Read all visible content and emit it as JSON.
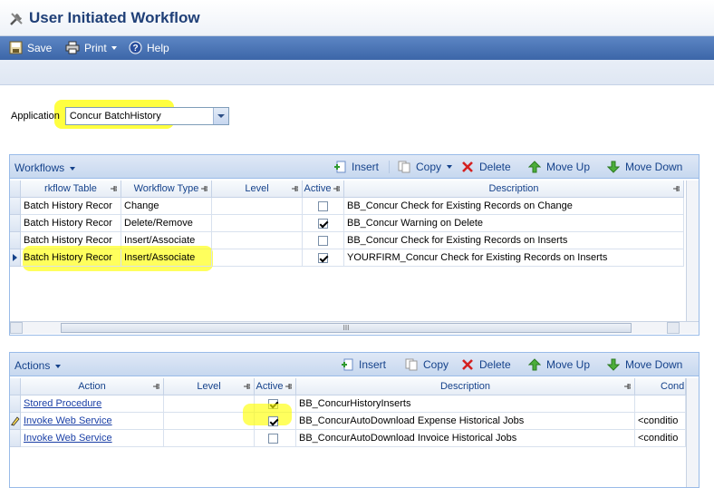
{
  "window": {
    "title": "User Initiated Workflow"
  },
  "toolbar": {
    "save": "Save",
    "print": "Print",
    "help": "Help"
  },
  "application": {
    "label": "Application",
    "value": "Concur BatchHistory"
  },
  "workflows": {
    "title": "Workflows",
    "buttons": {
      "insert": "Insert",
      "copy": "Copy",
      "delete": "Delete",
      "move_up": "Move Up",
      "move_down": "Move Down"
    },
    "columns": [
      "rkflow Table",
      "Workflow Type",
      "Level",
      "Active",
      "Description"
    ],
    "rows": [
      {
        "table": "Batch History Recor",
        "type": "Change",
        "level": "",
        "active": false,
        "description": "BB_Concur Check for Existing Records on Change"
      },
      {
        "table": "Batch History Recor",
        "type": "Delete/Remove",
        "level": "",
        "active": true,
        "description": "BB_Concur Warning on Delete"
      },
      {
        "table": "Batch History Recor",
        "type": "Insert/Associate",
        "level": "",
        "active": false,
        "description": "BB_Concur Check for Existing Records on Inserts"
      },
      {
        "table": "Batch History Recor",
        "type": "Insert/Associate",
        "level": "",
        "active": true,
        "description": "YOURFIRM_Concur Check for Existing Records on Inserts"
      }
    ],
    "scroll_glyph": "III"
  },
  "actions": {
    "title": "Actions",
    "buttons": {
      "insert": "Insert",
      "copy": "Copy",
      "delete": "Delete",
      "move_up": "Move Up",
      "move_down": "Move Down"
    },
    "columns": [
      "Action",
      "Level",
      "Active",
      "Description",
      "Cond"
    ],
    "rows": [
      {
        "action": "Stored Procedure",
        "level": "",
        "active": true,
        "description": "BB_ConcurHistoryInserts",
        "cond": ""
      },
      {
        "action": "Invoke Web Service",
        "level": "",
        "active": true,
        "description": "BB_ConcurAutoDownload Expense Historical Jobs",
        "cond": "<conditio"
      },
      {
        "action": "Invoke Web Service",
        "level": "",
        "active": false,
        "description": "BB_ConcurAutoDownload Invoice Historical Jobs",
        "cond": "<conditio"
      }
    ]
  },
  "colors": {
    "highlight": "#ffff00",
    "toolbar": "#3c66a8",
    "panel_header": "#c7d8ef",
    "link": "#1a3fa6"
  }
}
